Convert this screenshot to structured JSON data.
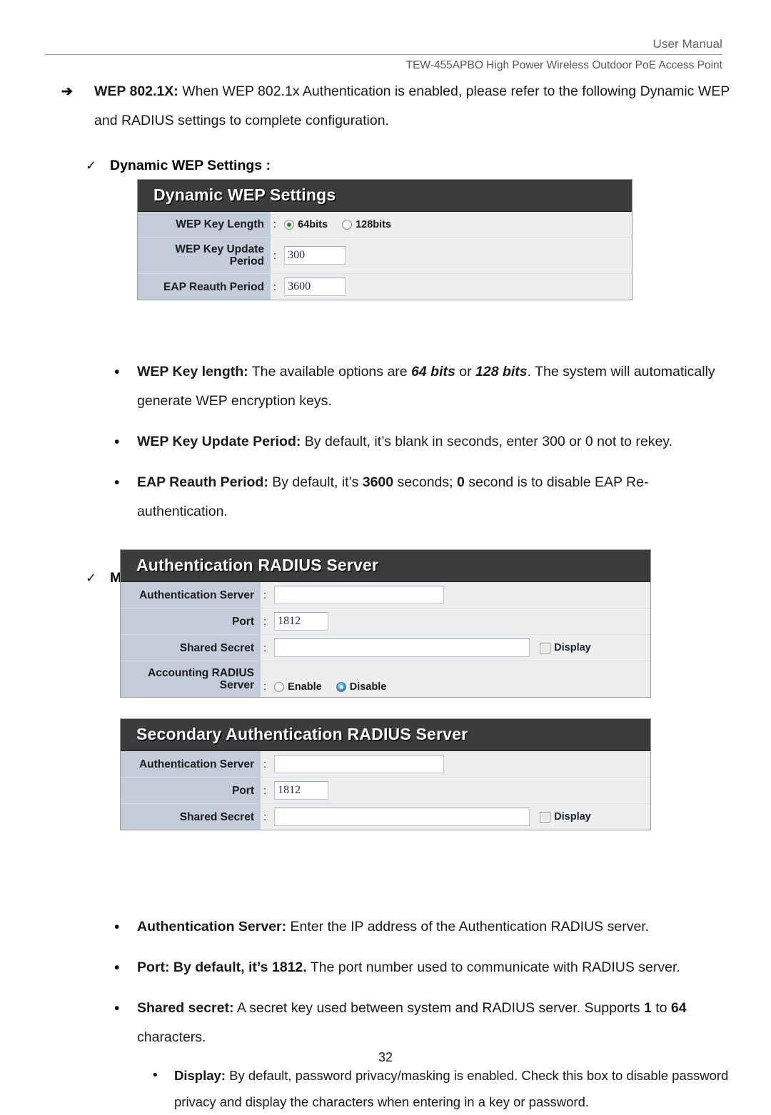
{
  "header": {
    "manual_label": "User Manual",
    "model_line": "TEW-455APBO High Power Wireless Outdoor PoE Access Point"
  },
  "intro": {
    "marker": "➔",
    "term": "WEP 802.1X:",
    "text": " When WEP 802.1x Authentication is enabled, please refer to the following Dynamic WEP and RADIUS settings to complete configuration."
  },
  "headings": {
    "check_marker": "✓",
    "dynamic_wep": "Dynamic WEP Settings :",
    "radius_servers": "Main and Secondary Authentication RADIUS Server Settings :"
  },
  "dynamic_wep_panel": {
    "title": "Dynamic WEP Settings",
    "rows": [
      {
        "label": "WEP Key Length",
        "colon": ":",
        "type": "radio",
        "options": [
          {
            "label": "64bits",
            "selected": true
          },
          {
            "label": "128bits",
            "selected": false
          }
        ]
      },
      {
        "label": "WEP Key Update Period",
        "colon": ":",
        "type": "text",
        "value": "300"
      },
      {
        "label": "EAP Reauth Period",
        "colon": ":",
        "type": "text",
        "value": "3600"
      }
    ]
  },
  "wep_bullets": [
    {
      "marker": "•",
      "term": "WEP Key length:",
      "segments": [
        {
          "t": " The available options are ",
          "style": "normal"
        },
        {
          "t": "64 bits",
          "style": "bolditalic"
        },
        {
          "t": " or ",
          "style": "normal"
        },
        {
          "t": "128 bits",
          "style": "bolditalic"
        },
        {
          "t": ". The system will automatically generate WEP encryption keys.",
          "style": "normal"
        }
      ]
    },
    {
      "marker": "•",
      "term": "WEP Key Update Period:",
      "segments": [
        {
          "t": " By default, it’s blank in seconds, enter 300 or 0 not to rekey.",
          "style": "normal"
        }
      ]
    },
    {
      "marker": "•",
      "term": "EAP Reauth Period:",
      "segments": [
        {
          "t": " By default, it’s ",
          "style": "normal"
        },
        {
          "t": "3600",
          "style": "bold"
        },
        {
          "t": " seconds; ",
          "style": "normal"
        },
        {
          "t": "0",
          "style": "bold"
        },
        {
          "t": " second is to disable EAP Re-authentication.",
          "style": "normal"
        }
      ]
    }
  ],
  "radius_panel": {
    "title": "Authentication RADIUS Server",
    "rows": [
      {
        "label": "Authentication Server",
        "colon": ":",
        "type": "text",
        "value": ""
      },
      {
        "label": "Port",
        "colon": ":",
        "type": "text",
        "value": "1812"
      },
      {
        "label": "Shared Secret",
        "colon": ":",
        "type": "secret",
        "value": "",
        "checkbox_label": "Display",
        "checkbox_checked": false
      },
      {
        "label": "Accounting RADIUS Server",
        "colon": ":",
        "type": "radio",
        "options": [
          {
            "label": "Enable",
            "selected": false
          },
          {
            "label": "Disable",
            "selected": true
          }
        ]
      }
    ]
  },
  "secondary_radius_panel": {
    "title": "Secondary Authentication RADIUS Server",
    "rows": [
      {
        "label": "Authentication Server",
        "colon": ":",
        "type": "text",
        "value": ""
      },
      {
        "label": "Port",
        "colon": ":",
        "type": "text",
        "value": "1812"
      },
      {
        "label": "Shared Secret",
        "colon": ":",
        "type": "secret",
        "value": "",
        "checkbox_label": "Display",
        "checkbox_checked": false
      }
    ]
  },
  "radius_bullets": [
    {
      "marker": "•",
      "term": "Authentication Server:",
      "segments": [
        {
          "t": " Enter the IP address of the Authentication RADIUS server.",
          "style": "normal"
        }
      ]
    },
    {
      "marker": "•",
      "term": "Port: By default, it’s 1812.",
      "segments": [
        {
          "t": " The port number used to communicate with RADIUS server.",
          "style": "normal"
        }
      ]
    },
    {
      "marker": "•",
      "term": "Shared secret:",
      "segments": [
        {
          "t": " A secret key used between system and RADIUS server. Supports ",
          "style": "normal"
        },
        {
          "t": "1",
          "style": "bold"
        },
        {
          "t": " to ",
          "style": "normal"
        },
        {
          "t": "64",
          "style": "bold"
        },
        {
          "t": " characters.",
          "style": "normal"
        }
      ]
    }
  ],
  "display_bullet": {
    "marker": "•",
    "term": "Display:",
    "segments": [
      {
        "t": " By default, password privacy/masking is enabled. Check this box to disable password privacy and display the characters when entering in a key or password.",
        "style": "normal"
      }
    ]
  },
  "footer": {
    "page_number": "32"
  },
  "colors": {
    "panel_title_bg": "#3c3c3c",
    "panel_label_bg": "#c3cdda",
    "panel_field_bg": "#eeeeee",
    "radio_selected_green": "#2f7d32",
    "radio_selected_blue": "#1769a8",
    "header_text": "#636363"
  }
}
